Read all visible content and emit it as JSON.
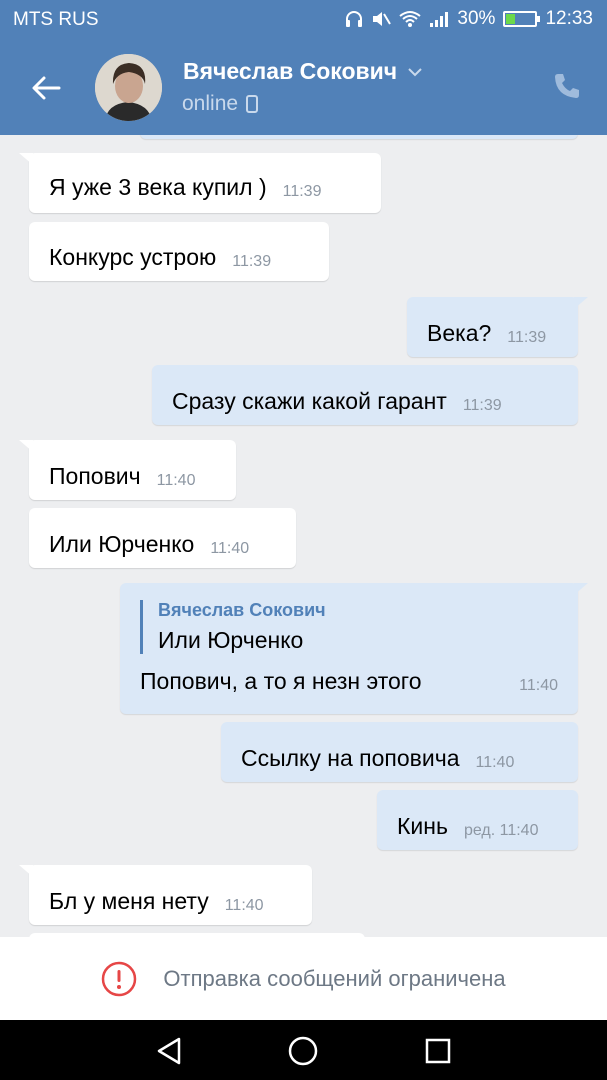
{
  "status_bar": {
    "carrier": "MTS RUS",
    "battery": "30%",
    "battery_level": 0.3,
    "time": "12:33"
  },
  "header": {
    "contact_name": "Вячеслав Сокович",
    "status": "online",
    "icons": [
      "back-arrow-icon",
      "chevron-down-icon",
      "mobile-icon",
      "phone-icon"
    ]
  },
  "messages": [
    {
      "text": "Я уже 3 века купил )",
      "time": "11:39",
      "direction": "in"
    },
    {
      "text": "Конкурс устрою",
      "time": "11:39",
      "direction": "in"
    },
    {
      "text": "Века?",
      "time": "11:39",
      "direction": "out"
    },
    {
      "text": "Сразу скажи какой гарант",
      "time": "11:39",
      "direction": "out"
    },
    {
      "text": "Попович",
      "time": "11:40",
      "direction": "in"
    },
    {
      "text": "Или Юрченко",
      "time": "11:40",
      "direction": "in"
    },
    {
      "quote_author": "Вячеслав Сокович",
      "quote_text": "Или Юрченко",
      "text": "Попович, а то я незн этого",
      "time": "11:40",
      "direction": "out"
    },
    {
      "text": "Ссылку на поповича",
      "time": "11:40",
      "direction": "out"
    },
    {
      "text": "Кинь",
      "time": "ред. 11:40",
      "direction": "out"
    },
    {
      "text": "Бл у меня нету",
      "time": "11:40",
      "direction": "in"
    }
  ],
  "footer": {
    "restricted_text": "Отправка сообщений ограничена"
  },
  "colors": {
    "header": "#5181b8",
    "background": "#edeef0",
    "outgoing": "#dbe8f7",
    "incoming": "#ffffff",
    "alert": "#e64646"
  }
}
